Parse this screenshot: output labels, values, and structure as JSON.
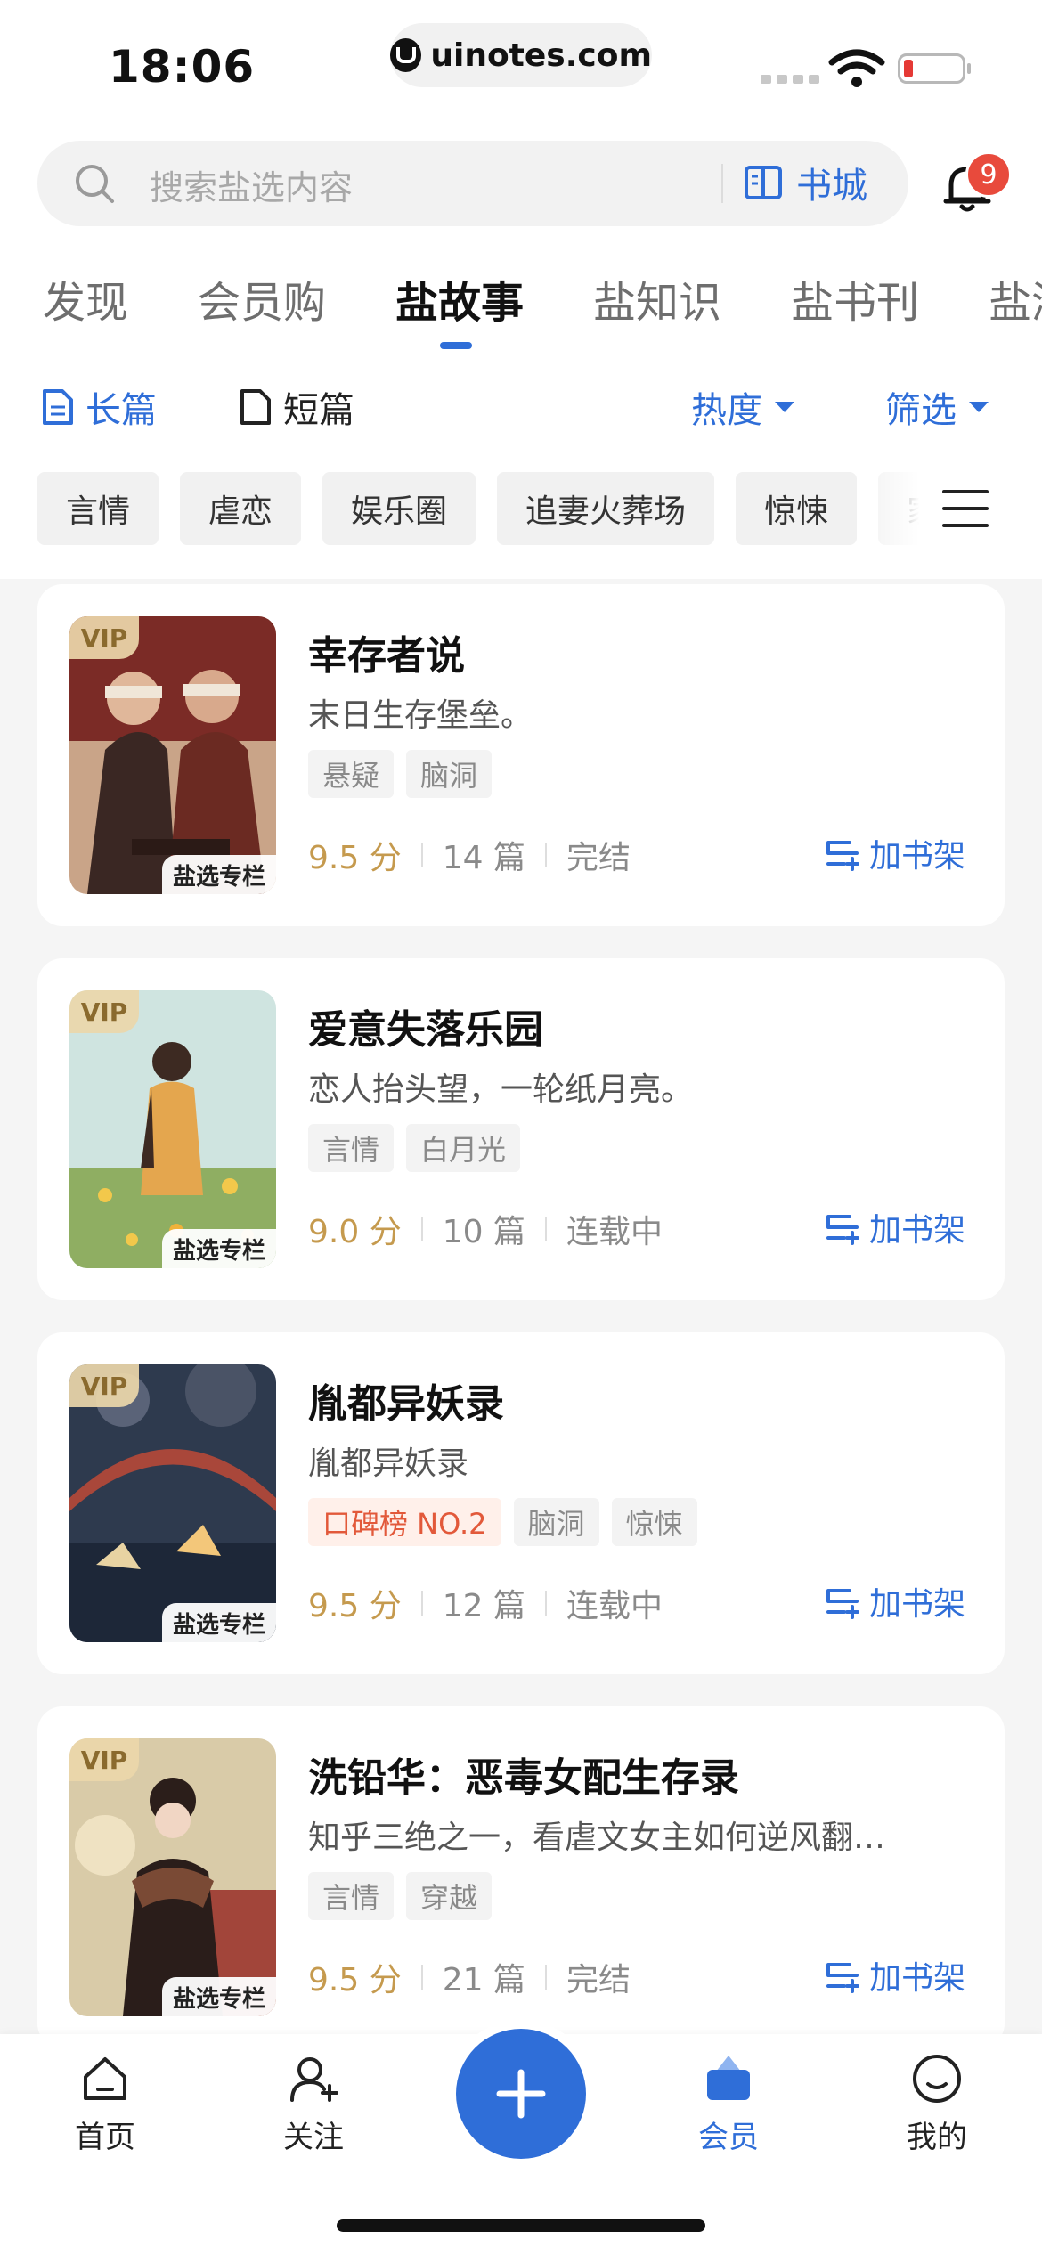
{
  "status": {
    "time": "18:06",
    "url": "uinotes.com"
  },
  "search": {
    "placeholder": "搜索盐选内容",
    "bookstore_label": "书城",
    "notification_count": "9"
  },
  "tabs": [
    "发现",
    "会员购",
    "盐故事",
    "盐知识",
    "盐书刊",
    "盐测"
  ],
  "active_tab": "盐故事",
  "filters": {
    "long_label": "长篇",
    "short_label": "短篇",
    "sort_label": "热度",
    "filter_label": "筛选"
  },
  "categories": [
    "言情",
    "虐恋",
    "娱乐圈",
    "追妻火葬场",
    "惊悚",
    "家"
  ],
  "books": [
    {
      "vip": "VIP",
      "column": "盐选专栏",
      "title": "幸存者说",
      "desc": "末日生存堡垒。",
      "tags": [
        "悬疑",
        "脑洞"
      ],
      "score": "9.5 分",
      "chapters": "14 篇",
      "status": "完结",
      "action": "加书架"
    },
    {
      "vip": "VIP",
      "column": "盐选专栏",
      "title": "爱意失落乐园",
      "desc": "恋人抬头望，一轮纸月亮。",
      "tags": [
        "言情",
        "白月光"
      ],
      "score": "9.0 分",
      "chapters": "10 篇",
      "status": "连载中",
      "action": "加书架"
    },
    {
      "vip": "VIP",
      "column": "盐选专栏",
      "title": "胤都异妖录",
      "desc": "胤都异妖录",
      "rank": "口碑榜 NO.2",
      "tags": [
        "脑洞",
        "惊悚"
      ],
      "score": "9.5 分",
      "chapters": "12 篇",
      "status": "连载中",
      "action": "加书架"
    },
    {
      "vip": "VIP",
      "column": "盐选专栏",
      "title": "洗铅华：恶毒女配生存录",
      "desc": "知乎三绝之一，看虐文女主如何逆风翻…",
      "tags": [
        "言情",
        "穿越"
      ],
      "score": "9.5 分",
      "chapters": "21 篇",
      "status": "完结",
      "action": "加书架"
    }
  ],
  "nav": {
    "home": "首页",
    "follow": "关注",
    "member": "会员",
    "mine": "我的"
  },
  "colors": {
    "accent": "#2f6ed8",
    "score": "#c59a4e",
    "badge": "#e84a3c"
  }
}
